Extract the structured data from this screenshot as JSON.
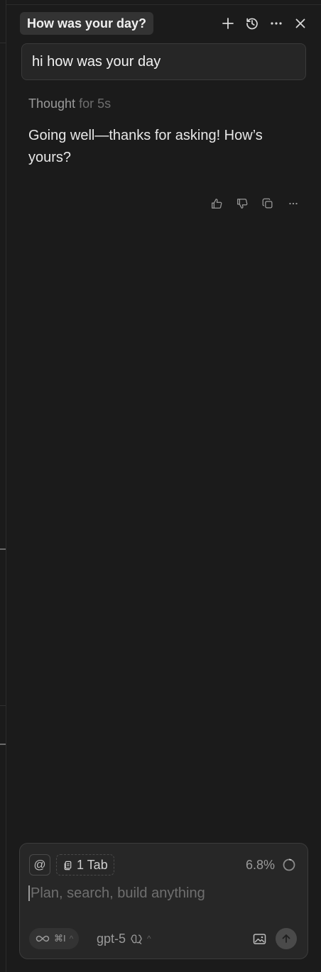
{
  "header": {
    "title": "How was your day?",
    "actions": [
      {
        "name": "new-chat",
        "icon": "plus-icon"
      },
      {
        "name": "history",
        "icon": "history-icon"
      },
      {
        "name": "more",
        "icon": "ellipsis-icon"
      },
      {
        "name": "close",
        "icon": "close-icon"
      }
    ]
  },
  "conversation": {
    "user_message": "hi how was your day",
    "thought_label": "Thought",
    "thought_duration": "for 5s",
    "assistant_reply": "Going well—thanks for asking! How’s yours?",
    "message_actions": [
      "thumbs-up-icon",
      "thumbs-down-icon",
      "copy-icon",
      "ellipsis-icon"
    ]
  },
  "composer": {
    "mention_symbol": "@",
    "context_chip": "1 Tab",
    "usage": "6.8%",
    "placeholder": "Plan, search, build anything",
    "mode_shortcut": "⌘I",
    "model": "gpt-5"
  },
  "colors": {
    "background": "#1b1b1b",
    "surface": "#272727",
    "border": "#3c3c3c",
    "text": "#e6e6e6",
    "muted": "#9a9a9a"
  }
}
